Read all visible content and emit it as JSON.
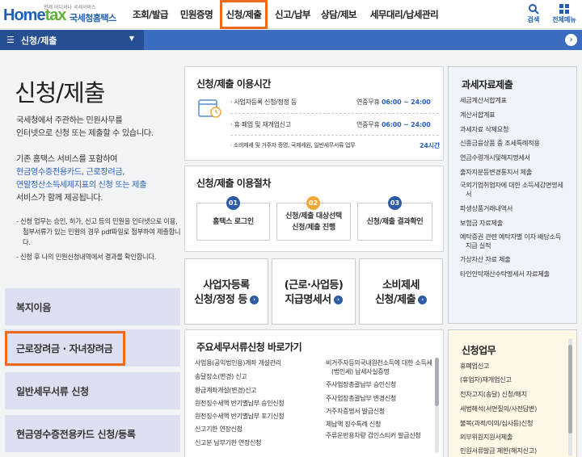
{
  "header": {
    "logo_sub": "언제 어디서나 국세서비스",
    "logo_main_1": "Home",
    "logo_main_2": "tax",
    "logo_korean": "국세청홈택스",
    "nav": [
      "조회/발급",
      "민원증명",
      "신청/제출",
      "신고/납부",
      "상담/제보",
      "세무대리/납세관리"
    ],
    "search_label": "검색",
    "allmenu_label": "전체메뉴"
  },
  "subbar": {
    "menu_label": "신청/제출"
  },
  "intro": {
    "title": "신청/제출",
    "p1_line1": "국세청에서 주관하는 민원사무를",
    "p1_line2": "인터넷으로 신청 또는 제출할 수 있습니다.",
    "p2_line1": "기존 홈택스 서비스를 포함하여",
    "p2_line2": "현금영수증전용카드, 근로장려금,",
    "p2_line3": "연말정산소득세제지표의 신청 또는 제출",
    "p2_line4": "서비스가 함께 제공됩니다.",
    "note1": "- 신청 업무는 승인, 허가, 신고 등의 민원을 인터넷으로 이용, 첨부서류가 있는 민원의 경우 pdf파일로 첨부하여 제출합니다.",
    "note2": "- 신청 후 나의 민원신청내역에서 결과를 확인합니다."
  },
  "left_buttons": [
    "복지이음",
    "근로장려금 · 자녀장려금",
    "일반세무서류 신청",
    "현금영수증전용카드 신청/등록"
  ],
  "hours": {
    "title": "신청/제출 이용시간",
    "rows": [
      {
        "label": "사업자등록 신청/정정 등",
        "prefix": "연중무휴",
        "time": "06:00 ~ 24:00"
      },
      {
        "label": "휴·폐업 및 재개업신고",
        "prefix": "연중무휴",
        "time": "06:00 ~ 24:00"
      },
      {
        "label": "소비제세 및 거주자 증명, 국제세원, 일반세무서류 업무",
        "prefix": "",
        "time": "24시간"
      }
    ]
  },
  "procedure": {
    "title": "신청/제출 이용절차",
    "steps": [
      {
        "num": "01",
        "line1": "홈택스 로그인",
        "line2": ""
      },
      {
        "num": "02",
        "line1": "신청/제출 대상선택",
        "line2": "신청/제출 진행"
      },
      {
        "num": "03",
        "line1": "신청/제출 결과확인",
        "line2": ""
      }
    ]
  },
  "cards": [
    {
      "line1": "사업자등록",
      "line2": "신청/정정 등"
    },
    {
      "line1": "(근로·사업등)",
      "line2": "지급명세서"
    },
    {
      "line1": "소비제세",
      "line2": "신청/제출"
    }
  ],
  "quick": {
    "title": "주요세무서류신청 바로가기",
    "left": [
      "사업용(공익법인용)계좌 개설관리",
      "송달장소(변경) 신고",
      "환급계좌개설(변경)신고",
      "원천징수세액 반기별납부 승인신청",
      "원천징수세액 반기별납부 포기신청",
      "신고기한 연장신청",
      "신고분 납부기한 연장신청"
    ],
    "right": [
      "비거주자등의국내원천소득에 대한 소득세(법인세) 납세사실증명",
      "주사업장총괄납부 승인신청",
      "주사업장총괄납부 변경신청",
      "거주자증명서 발급신청",
      "체납액 징수특례 신청",
      "주류운반용차량 검인스티커 발급신청"
    ]
  },
  "tax_data": {
    "title": "과세자료제출",
    "items": [
      "세금계산서합계표",
      "계산서합계표",
      "과세자료 삭제요청",
      "신종금융상품 중 조세특례적용",
      "연금수령개시및해지명세서",
      "출자지분등변경통지서 제출",
      "국외기업취업자에 대한 소득세감면명세서",
      "파생상품거래내역서",
      "보험금 자료제출",
      "예탁증권 관련 예탁자별 이자 배당소득 지급 실적",
      "가상자산 자료 제출",
      "타인인탁재산수탁명세서 자료제출"
    ]
  },
  "apply": {
    "title": "신청업무",
    "items": [
      "휴폐업신고",
      "(휴업자)재개업신고",
      "전자고지(송달) 신청/해지",
      "세법해석(서면질의/사전답변)",
      "불복(과적/이의/심사등)신청",
      "외부위원지원서제출",
      "민원서류발급 제한(해지신고)"
    ]
  },
  "colors": {
    "accent": "#f06a1e",
    "brand": "#254e93",
    "blue_text": "#2a61c0"
  }
}
